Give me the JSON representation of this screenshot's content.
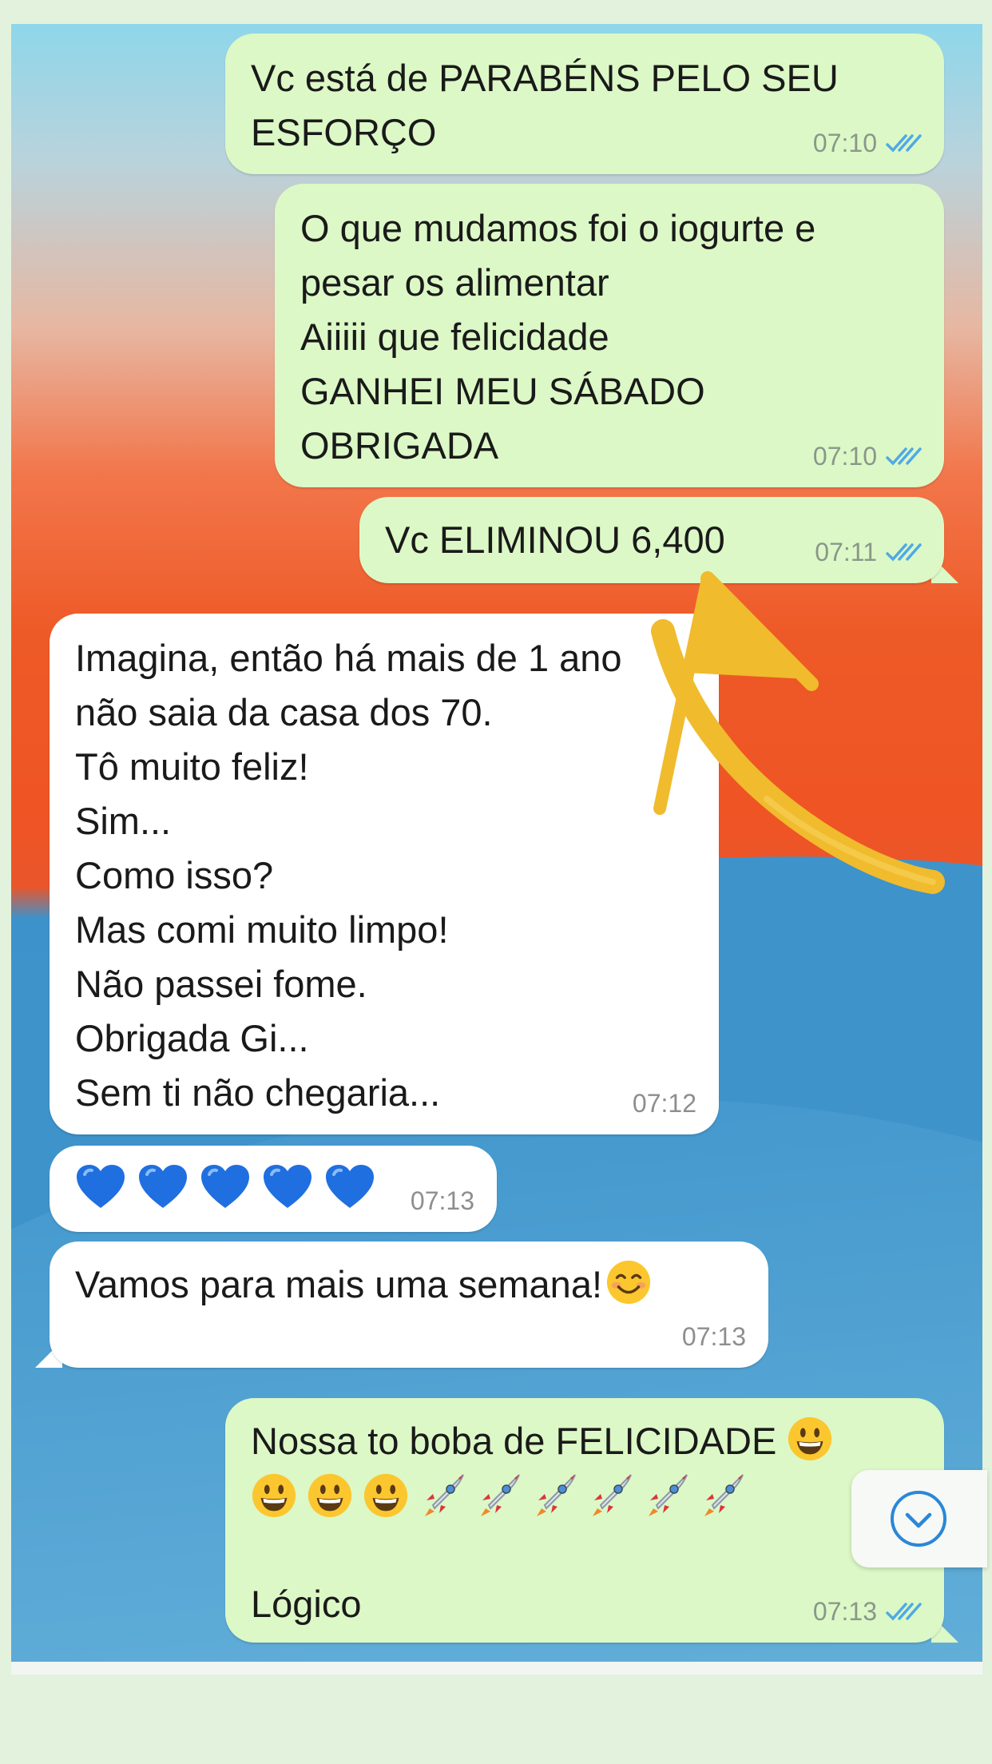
{
  "messages": [
    {
      "id": "m1",
      "dir": "out",
      "text": "Vc está de PARABÉNS PELO SEU\nESFORÇO",
      "time": "07:10",
      "status": "read"
    },
    {
      "id": "m2",
      "dir": "out",
      "text": "O que mudamos foi o iogurte e\npesar os alimentar\nAiiiii que felicidade\nGANHEI MEU SÁBADO\nOBRIGADA",
      "time": "07:10",
      "status": "read"
    },
    {
      "id": "m3",
      "dir": "out",
      "text": "Vc ELIMINOU 6,400",
      "time": "07:11",
      "status": "read"
    },
    {
      "id": "m4",
      "dir": "in",
      "text": "Imagina, então há mais de 1 ano\nnão saia da casa dos 70.\nTô muito feliz!\nSim...\nComo isso?\nMas comi muito limpo!\nNão passei fome.\nObrigada Gi...\nSem ti não chegaria...",
      "time": "07:12"
    },
    {
      "id": "m5",
      "dir": "in",
      "text": "💙💙💙💙💙",
      "time": "07:13"
    },
    {
      "id": "m6",
      "dir": "in",
      "text": "Vamos para mais uma semana!",
      "emoji": "smiling-face",
      "time": "07:13"
    },
    {
      "id": "m7",
      "dir": "out",
      "text_line1": "Nossa to boba de FELICIDADE",
      "text_last": "Lógico",
      "time": "07:13",
      "status": "read"
    }
  ],
  "colors": {
    "outgoing_bubble": "#dcf8c6",
    "incoming_bubble": "#ffffff",
    "read_check": "#4fa9e6",
    "annotation_arrow": "#f0bb2d",
    "scroll_icon": "#2b87d8"
  },
  "icons": {
    "read_receipt": "double-check-icon",
    "scroll_down": "chevron-down-circle-icon",
    "annotation": "hand-drawn-arrow"
  },
  "emoji_rows": {
    "m7_line1_end": "grinning-face",
    "m7_line2": [
      "grinning-face",
      "grinning-face",
      "grinning-face",
      "rocket",
      "rocket",
      "rocket",
      "rocket",
      "rocket",
      "rocket"
    ]
  }
}
